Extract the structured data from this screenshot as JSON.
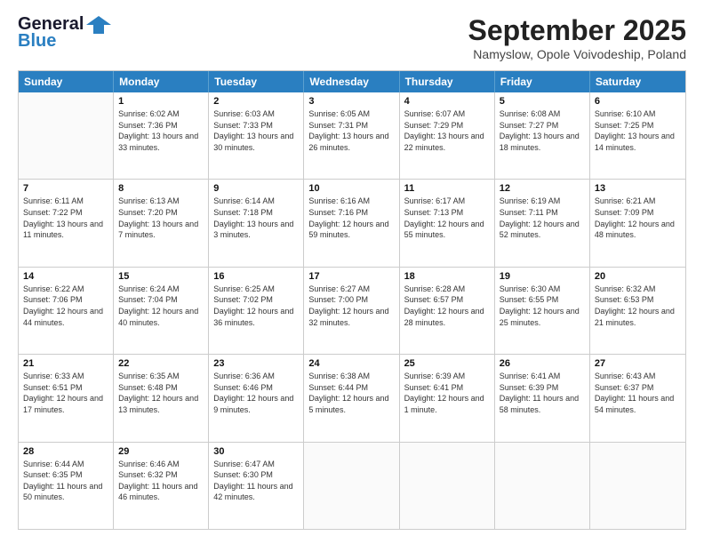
{
  "header": {
    "logo_line1": "General",
    "logo_line2": "Blue",
    "month_title": "September 2025",
    "subtitle": "Namyslow, Opole Voivodeship, Poland"
  },
  "weekdays": [
    "Sunday",
    "Monday",
    "Tuesday",
    "Wednesday",
    "Thursday",
    "Friday",
    "Saturday"
  ],
  "weeks": [
    [
      {
        "day": "",
        "text": ""
      },
      {
        "day": "1",
        "text": "Sunrise: 6:02 AM\nSunset: 7:36 PM\nDaylight: 13 hours and 33 minutes."
      },
      {
        "day": "2",
        "text": "Sunrise: 6:03 AM\nSunset: 7:33 PM\nDaylight: 13 hours and 30 minutes."
      },
      {
        "day": "3",
        "text": "Sunrise: 6:05 AM\nSunset: 7:31 PM\nDaylight: 13 hours and 26 minutes."
      },
      {
        "day": "4",
        "text": "Sunrise: 6:07 AM\nSunset: 7:29 PM\nDaylight: 13 hours and 22 minutes."
      },
      {
        "day": "5",
        "text": "Sunrise: 6:08 AM\nSunset: 7:27 PM\nDaylight: 13 hours and 18 minutes."
      },
      {
        "day": "6",
        "text": "Sunrise: 6:10 AM\nSunset: 7:25 PM\nDaylight: 13 hours and 14 minutes."
      }
    ],
    [
      {
        "day": "7",
        "text": "Sunrise: 6:11 AM\nSunset: 7:22 PM\nDaylight: 13 hours and 11 minutes."
      },
      {
        "day": "8",
        "text": "Sunrise: 6:13 AM\nSunset: 7:20 PM\nDaylight: 13 hours and 7 minutes."
      },
      {
        "day": "9",
        "text": "Sunrise: 6:14 AM\nSunset: 7:18 PM\nDaylight: 13 hours and 3 minutes."
      },
      {
        "day": "10",
        "text": "Sunrise: 6:16 AM\nSunset: 7:16 PM\nDaylight: 12 hours and 59 minutes."
      },
      {
        "day": "11",
        "text": "Sunrise: 6:17 AM\nSunset: 7:13 PM\nDaylight: 12 hours and 55 minutes."
      },
      {
        "day": "12",
        "text": "Sunrise: 6:19 AM\nSunset: 7:11 PM\nDaylight: 12 hours and 52 minutes."
      },
      {
        "day": "13",
        "text": "Sunrise: 6:21 AM\nSunset: 7:09 PM\nDaylight: 12 hours and 48 minutes."
      }
    ],
    [
      {
        "day": "14",
        "text": "Sunrise: 6:22 AM\nSunset: 7:06 PM\nDaylight: 12 hours and 44 minutes."
      },
      {
        "day": "15",
        "text": "Sunrise: 6:24 AM\nSunset: 7:04 PM\nDaylight: 12 hours and 40 minutes."
      },
      {
        "day": "16",
        "text": "Sunrise: 6:25 AM\nSunset: 7:02 PM\nDaylight: 12 hours and 36 minutes."
      },
      {
        "day": "17",
        "text": "Sunrise: 6:27 AM\nSunset: 7:00 PM\nDaylight: 12 hours and 32 minutes."
      },
      {
        "day": "18",
        "text": "Sunrise: 6:28 AM\nSunset: 6:57 PM\nDaylight: 12 hours and 28 minutes."
      },
      {
        "day": "19",
        "text": "Sunrise: 6:30 AM\nSunset: 6:55 PM\nDaylight: 12 hours and 25 minutes."
      },
      {
        "day": "20",
        "text": "Sunrise: 6:32 AM\nSunset: 6:53 PM\nDaylight: 12 hours and 21 minutes."
      }
    ],
    [
      {
        "day": "21",
        "text": "Sunrise: 6:33 AM\nSunset: 6:51 PM\nDaylight: 12 hours and 17 minutes."
      },
      {
        "day": "22",
        "text": "Sunrise: 6:35 AM\nSunset: 6:48 PM\nDaylight: 12 hours and 13 minutes."
      },
      {
        "day": "23",
        "text": "Sunrise: 6:36 AM\nSunset: 6:46 PM\nDaylight: 12 hours and 9 minutes."
      },
      {
        "day": "24",
        "text": "Sunrise: 6:38 AM\nSunset: 6:44 PM\nDaylight: 12 hours and 5 minutes."
      },
      {
        "day": "25",
        "text": "Sunrise: 6:39 AM\nSunset: 6:41 PM\nDaylight: 12 hours and 1 minute."
      },
      {
        "day": "26",
        "text": "Sunrise: 6:41 AM\nSunset: 6:39 PM\nDaylight: 11 hours and 58 minutes."
      },
      {
        "day": "27",
        "text": "Sunrise: 6:43 AM\nSunset: 6:37 PM\nDaylight: 11 hours and 54 minutes."
      }
    ],
    [
      {
        "day": "28",
        "text": "Sunrise: 6:44 AM\nSunset: 6:35 PM\nDaylight: 11 hours and 50 minutes."
      },
      {
        "day": "29",
        "text": "Sunrise: 6:46 AM\nSunset: 6:32 PM\nDaylight: 11 hours and 46 minutes."
      },
      {
        "day": "30",
        "text": "Sunrise: 6:47 AM\nSunset: 6:30 PM\nDaylight: 11 hours and 42 minutes."
      },
      {
        "day": "",
        "text": ""
      },
      {
        "day": "",
        "text": ""
      },
      {
        "day": "",
        "text": ""
      },
      {
        "day": "",
        "text": ""
      }
    ]
  ]
}
